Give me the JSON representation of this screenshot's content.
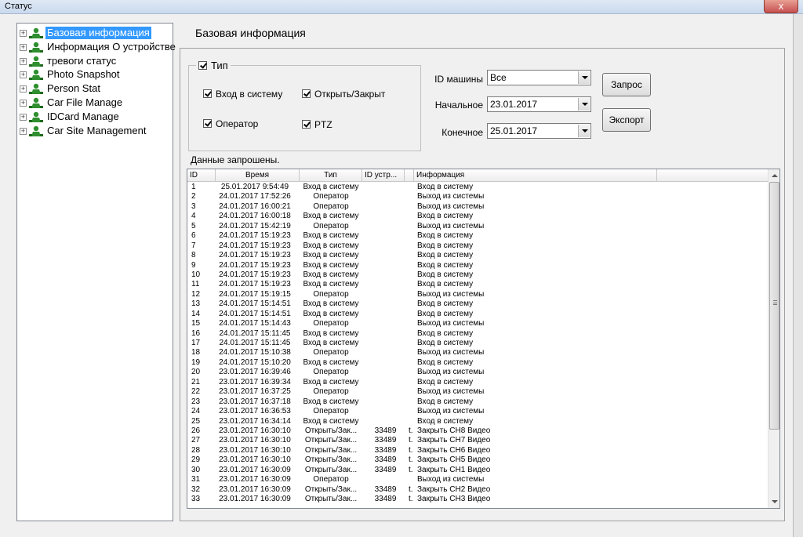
{
  "window": {
    "title": "Статус",
    "close_label": "x"
  },
  "tree": {
    "items": [
      {
        "label": "Базовая информация",
        "selected": true
      },
      {
        "label": "Информация О устройстве",
        "selected": false
      },
      {
        "label": "тревоги статус",
        "selected": false
      },
      {
        "label": "Photo Snapshot",
        "selected": false
      },
      {
        "label": "Person Stat",
        "selected": false
      },
      {
        "label": "Car File Manage",
        "selected": false
      },
      {
        "label": "IDCard Manage",
        "selected": false
      },
      {
        "label": "Car Site Management",
        "selected": false
      }
    ],
    "expander": "+"
  },
  "main": {
    "title": "Базовая информация",
    "type_group": {
      "legend": "Тип",
      "options": {
        "login": "Вход в систему",
        "openclose": "Открыть/Закрыт",
        "operator": "Оператор",
        "ptz": "PTZ"
      }
    },
    "filters": {
      "machine_label": "ID машины",
      "machine_value": "Все",
      "start_label": "Начальное",
      "start_value": "23.01.2017",
      "end_label": "Конечное",
      "end_value": "25.01.2017"
    },
    "buttons": {
      "query": "Запрос",
      "export": "Экспорт"
    },
    "status": "Данные запрошены."
  },
  "table": {
    "headers": [
      "ID",
      "Время",
      "Тип",
      "ID устр...",
      "",
      "Информация"
    ],
    "rows": [
      [
        "1",
        "25.01.2017 9:54:49",
        "Вход в систему",
        "",
        "",
        "Вход в систему"
      ],
      [
        "2",
        "24.01.2017 17:52:26",
        "Оператор",
        "",
        "",
        "Выход из системы"
      ],
      [
        "3",
        "24.01.2017 16:00:21",
        "Оператор",
        "",
        "",
        "Выход из системы"
      ],
      [
        "4",
        "24.01.2017 16:00:18",
        "Вход в систему",
        "",
        "",
        "Вход в систему"
      ],
      [
        "5",
        "24.01.2017 15:42:19",
        "Оператор",
        "",
        "",
        "Выход из системы"
      ],
      [
        "6",
        "24.01.2017 15:19:23",
        "Вход в систему",
        "",
        "",
        "Вход в систему"
      ],
      [
        "7",
        "24.01.2017 15:19:23",
        "Вход в систему",
        "",
        "",
        "Вход в систему"
      ],
      [
        "8",
        "24.01.2017 15:19:23",
        "Вход в систему",
        "",
        "",
        "Вход в систему"
      ],
      [
        "9",
        "24.01.2017 15:19:23",
        "Вход в систему",
        "",
        "",
        "Вход в систему"
      ],
      [
        "10",
        "24.01.2017 15:19:23",
        "Вход в систему",
        "",
        "",
        "Вход в систему"
      ],
      [
        "11",
        "24.01.2017 15:19:23",
        "Вход в систему",
        "",
        "",
        "Вход в систему"
      ],
      [
        "12",
        "24.01.2017 15:19:15",
        "Оператор",
        "",
        "",
        "Выход из системы"
      ],
      [
        "13",
        "24.01.2017 15:14:51",
        "Вход в систему",
        "",
        "",
        "Вход в систему"
      ],
      [
        "14",
        "24.01.2017 15:14:51",
        "Вход в систему",
        "",
        "",
        "Вход в систему"
      ],
      [
        "15",
        "24.01.2017 15:14:43",
        "Оператор",
        "",
        "",
        "Выход из системы"
      ],
      [
        "16",
        "24.01.2017 15:11:45",
        "Вход в систему",
        "",
        "",
        "Вход в систему"
      ],
      [
        "17",
        "24.01.2017 15:11:45",
        "Вход в систему",
        "",
        "",
        "Вход в систему"
      ],
      [
        "18",
        "24.01.2017 15:10:38",
        "Оператор",
        "",
        "",
        "Выход из системы"
      ],
      [
        "19",
        "24.01.2017 15:10:20",
        "Вход в систему",
        "",
        "",
        "Вход в систему"
      ],
      [
        "20",
        "23.01.2017 16:39:46",
        "Оператор",
        "",
        "",
        "Выход из системы"
      ],
      [
        "21",
        "23.01.2017 16:39:34",
        "Вход в систему",
        "",
        "",
        "Вход в систему"
      ],
      [
        "22",
        "23.01.2017 16:37:25",
        "Оператор",
        "",
        "",
        "Выход из системы"
      ],
      [
        "23",
        "23.01.2017 16:37:18",
        "Вход в систему",
        "",
        "",
        "Вход в систему"
      ],
      [
        "24",
        "23.01.2017 16:36:53",
        "Оператор",
        "",
        "",
        "Выход из системы"
      ],
      [
        "25",
        "23.01.2017 16:34:14",
        "Вход в систему",
        "",
        "",
        "Вход в систему"
      ],
      [
        "26",
        "23.01.2017 16:30:10",
        "Открыть/Зак...",
        "33489",
        "t.",
        "Закрыть CH8 Видео"
      ],
      [
        "27",
        "23.01.2017 16:30:10",
        "Открыть/Зак...",
        "33489",
        "t.",
        "Закрыть CH7 Видео"
      ],
      [
        "28",
        "23.01.2017 16:30:10",
        "Открыть/Зак...",
        "33489",
        "t.",
        "Закрыть CH6 Видео"
      ],
      [
        "29",
        "23.01.2017 16:30:10",
        "Открыть/Зак...",
        "33489",
        "t.",
        "Закрыть CH5 Видео"
      ],
      [
        "30",
        "23.01.2017 16:30:09",
        "Открыть/Зак...",
        "33489",
        "t.",
        "Закрыть CH1 Видео"
      ],
      [
        "31",
        "23.01.2017 16:30:09",
        "Оператор",
        "",
        "",
        "Выход из системы"
      ],
      [
        "32",
        "23.01.2017 16:30:09",
        "Открыть/Зак...",
        "33489",
        "t.",
        "Закрыть CH2 Видео"
      ],
      [
        "33",
        "23.01.2017 16:30:09",
        "Открыть/Зак...",
        "33489",
        "t.",
        "Закрыть CH3 Видео"
      ]
    ]
  }
}
